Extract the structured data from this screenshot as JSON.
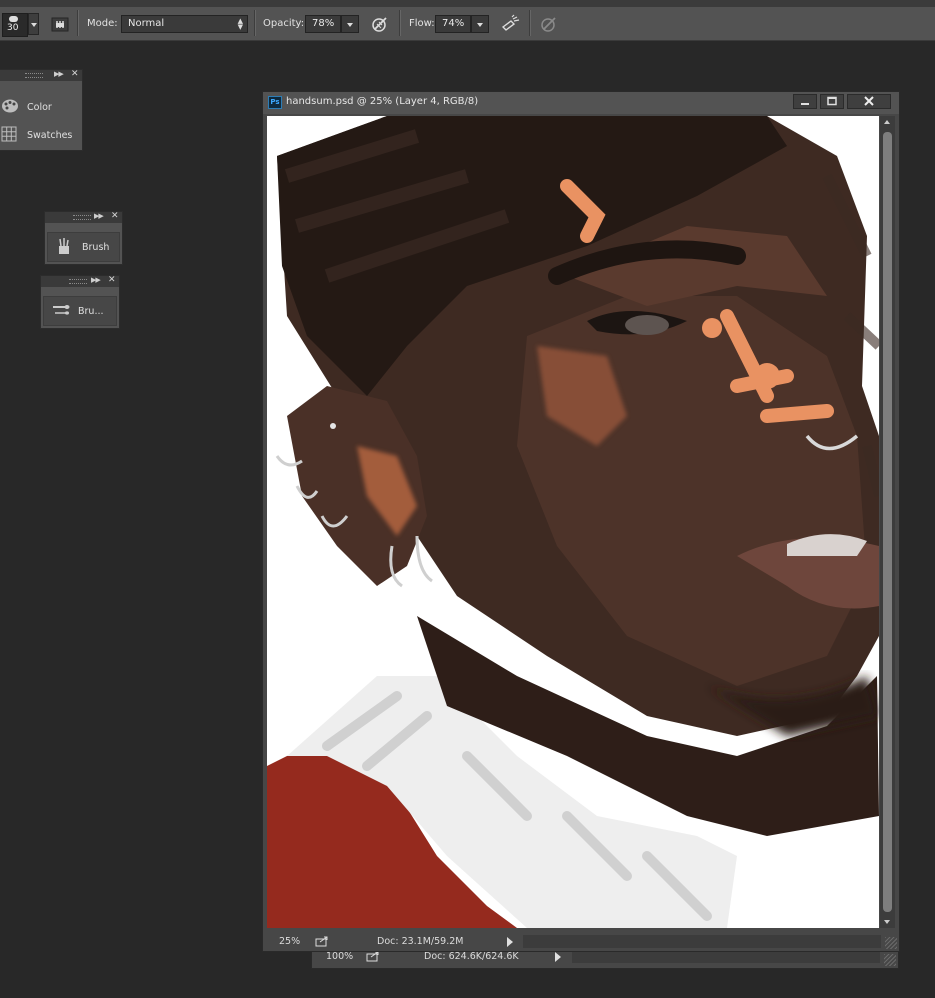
{
  "options_bar": {
    "brush_size": "30",
    "mode_label": "Mode:",
    "mode_value": "Normal",
    "opacity_label": "Opacity:",
    "opacity_value": "78%",
    "flow_label": "Flow:",
    "flow_value": "74%"
  },
  "panels": {
    "color_label": "Color",
    "swatches_label": "Swatches",
    "brush_label": "Brush",
    "brush_presets_label": "Bru..."
  },
  "document": {
    "title": "handsum.psd @ 25% (Layer 4, RGB/8)",
    "zoom": "25%",
    "doc_size": "Doc: 23.1M/59.2M",
    "badge": "Ps"
  },
  "document2": {
    "zoom": "100%",
    "doc_size": "Doc: 624.6K/624.6K"
  },
  "colors": {
    "ui_dark": "#282828",
    "ui_panel": "#535353",
    "ps_blue": "#3ea8ff",
    "skin_dark": "#3b2820",
    "skin_light": "#d98a5f",
    "shirt_red": "#952a1e"
  }
}
